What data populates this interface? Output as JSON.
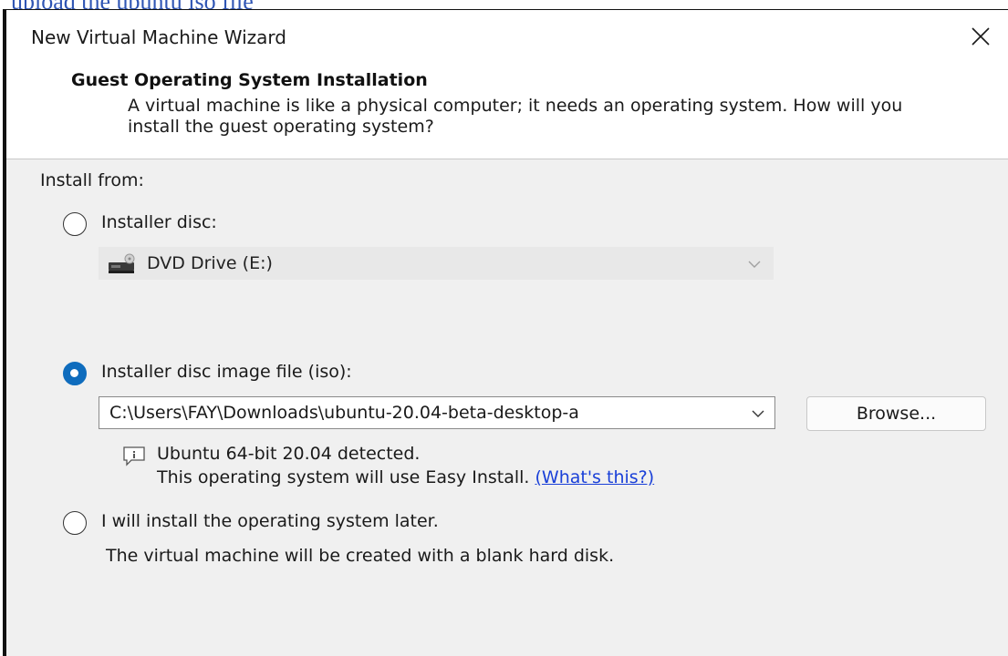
{
  "caption": "upload the ubuntu iso file",
  "window": {
    "title": "New Virtual Machine Wizard"
  },
  "header": {
    "title": "Guest Operating System Installation",
    "description": "A virtual machine is like a physical computer; it needs an operating system. How will you install the guest operating system?"
  },
  "install_from_label": "Install from:",
  "options": {
    "disc": {
      "label": "Installer disc:",
      "selected": false,
      "drive": "DVD Drive (E:)"
    },
    "iso": {
      "label": "Installer disc image file (iso):",
      "selected": true,
      "path": "C:\\Users\\FAY\\Downloads\\ubuntu-20.04-beta-desktop-a",
      "browse_label": "Browse...",
      "detected": "Ubuntu 64-bit 20.04 detected.",
      "easy_install": "This operating system will use Easy Install.",
      "whats_this": "(What's this?)"
    },
    "later": {
      "label": "I will install the operating system later.",
      "selected": false,
      "note": "The virtual machine will be created with a blank hard disk."
    }
  },
  "colors": {
    "accent": "#0f6cbd",
    "link": "#1a40d8",
    "caption": "#2f55b4"
  }
}
